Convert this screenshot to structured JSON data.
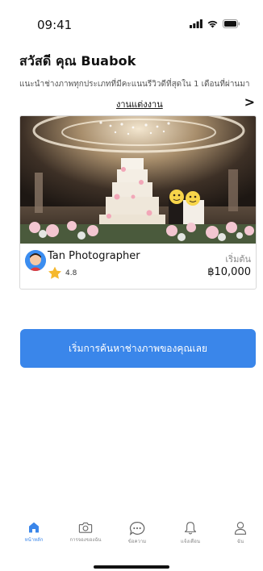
{
  "status_bar": {
    "time": "09:41"
  },
  "header": {
    "greeting": "สวัสดี คุณ Buabok"
  },
  "recommendation": {
    "subtitle": "แนะนำช่างภาพทุกประเภทที่มีคะแนนรีวิวดีที่สุดใน 1 เดือนที่ผ่านมา",
    "category": "งานแต่งงาน",
    "next_glyph": ">"
  },
  "card": {
    "photographer": "Tan Photographer",
    "rating": "4.8",
    "price_label": "เริ่มต้น",
    "price": "฿10,000"
  },
  "cta": {
    "label": "เริ่มการค้นหาช่างภาพของคุณเลย"
  },
  "tabs": [
    {
      "label": "หน้าหลัก",
      "icon": "home-icon",
      "active": true
    },
    {
      "label": "การจองของฉัน",
      "icon": "camera-icon",
      "active": false
    },
    {
      "label": "ข้อความ",
      "icon": "chat-icon",
      "active": false
    },
    {
      "label": "แจ้งเตือน",
      "icon": "bell-icon",
      "active": false
    },
    {
      "label": "ฉัน",
      "icon": "profile-icon",
      "active": false
    }
  ],
  "colors": {
    "accent": "#3a86ea",
    "star": "#f5b82e"
  }
}
